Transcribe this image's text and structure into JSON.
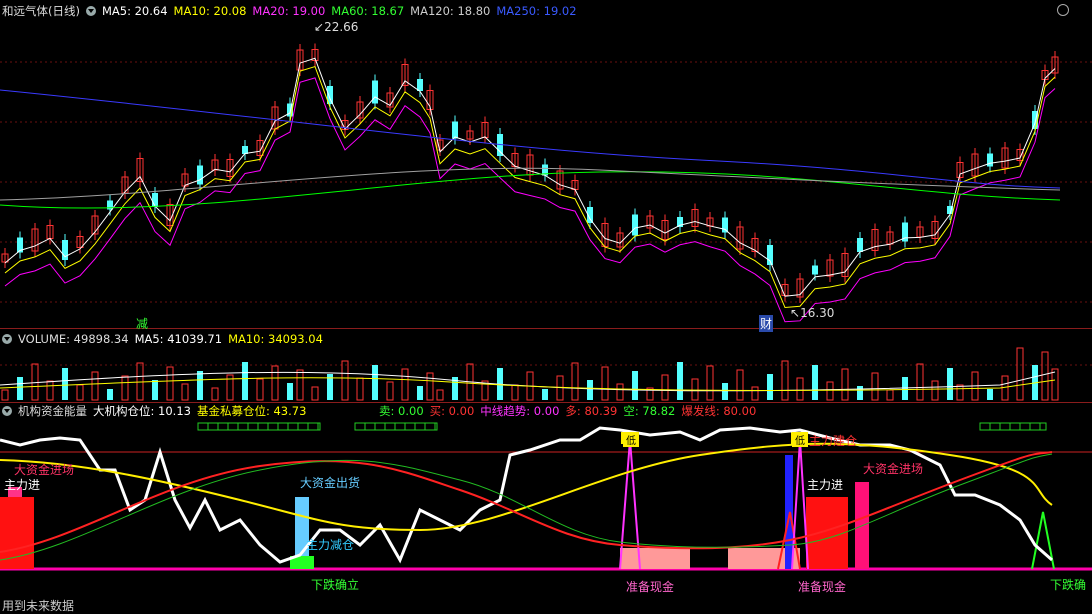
{
  "main": {
    "title": "和远气体(日线)",
    "ma5_label": "MA5: 20.64",
    "ma10_label": "MA10: 20.08",
    "ma20_label": "MA20: 19.00",
    "ma60_label": "MA60: 18.67",
    "ma120_label": "MA120: 18.80",
    "ma250_label": "MA250: 19.02",
    "high_label": "22.66",
    "low_label": "16.30",
    "mark_jian": "减",
    "mark_cai": "财",
    "colors": {
      "ma5": "#ffffff",
      "ma10": "#ffff00",
      "ma20": "#ff00ff",
      "ma60": "#00ff00",
      "ma120": "#a0a0a0",
      "ma250": "#3a3aff",
      "up": "#ff3333",
      "down": "#54ffff"
    }
  },
  "volume": {
    "volume_label": "VOLUME: 49898.34",
    "ma5_label": "MA5: 41039.71",
    "ma10_label": "MA10: 34093.04"
  },
  "indicator": {
    "name": "机构资金能量",
    "inst_label": "大机构仓位: 10.13",
    "fund_label": "基金私募仓位: 43.73",
    "sell_label": "卖: 0.00",
    "buy_label": "买: 0.00",
    "trend_label": "中线趋势: 0.00",
    "long_label": "多: 80.39",
    "short_label": "空: 78.82",
    "burst_label": "爆发线: 80.00",
    "big_in_left": "大资金进场",
    "main_in_left": "主力进",
    "big_out": "大资金出货",
    "main_position": "主力减仓",
    "fall_confirm": "下跌确立",
    "prepare_cash_1": "准备现金",
    "main_in_mid": "主力进",
    "main_holding": "主力建仓",
    "big_in_right": "大资金进场",
    "prepare_cash_2": "准备现金",
    "fall_confirm_right": "下跌确",
    "mark_di": "低"
  },
  "footer": {
    "future_data": "用到未来数据"
  }
}
